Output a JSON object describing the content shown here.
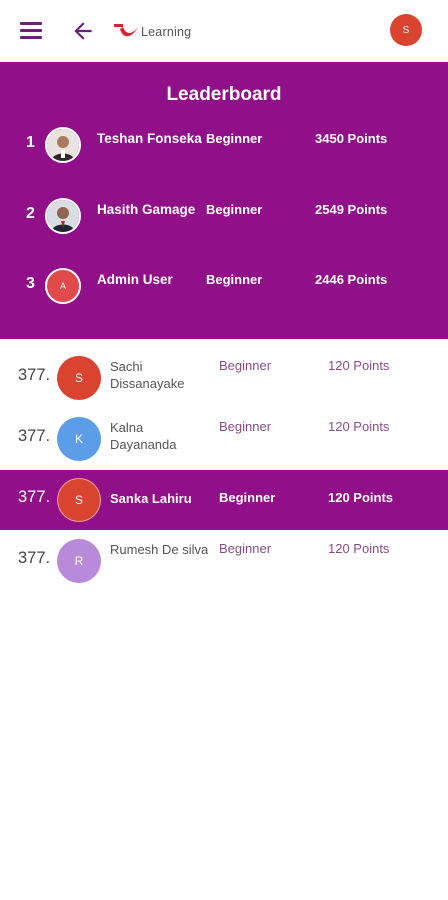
{
  "appbar": {
    "logo_text": "Learning",
    "user_initial": "S",
    "colors": {
      "accent": "#6e1f78",
      "logo_red": "#d6232f",
      "avatar": "#d9432f"
    }
  },
  "leaderboard": {
    "title": "Leaderboard",
    "background": "#920f8a",
    "top": [
      {
        "rank": "1",
        "name": "Teshan Fonseka",
        "level": "Beginner",
        "points": "3450 Points",
        "avatar": "photo"
      },
      {
        "rank": "2",
        "name": "Hasith Gamage",
        "level": "Beginner",
        "points": "2549 Points",
        "avatar": "photo"
      },
      {
        "rank": "3",
        "name": "Admin User",
        "level": "Beginner",
        "points": "2446 Points",
        "avatar": "A"
      }
    ]
  },
  "list": [
    {
      "rank": "377.",
      "initial": "S",
      "name": "Sachi Dissanayake",
      "level": "Beginner",
      "points": "120 Points",
      "color": "#d9432f",
      "highlight": false
    },
    {
      "rank": "377.",
      "initial": "K",
      "name": "Kalna Dayananda",
      "level": "Beginner",
      "points": "120 Points",
      "color": "#5b9de6",
      "highlight": false
    },
    {
      "rank": "377.",
      "initial": "S",
      "name": "Sanka Lahiru",
      "level": "Beginner",
      "points": "120 Points",
      "color": "#d9432f",
      "highlight": true
    },
    {
      "rank": "377.",
      "initial": "R",
      "name": "Rumesh De silva",
      "level": "Beginner",
      "points": "120 Points",
      "color": "#b98ad9",
      "highlight": false
    }
  ]
}
